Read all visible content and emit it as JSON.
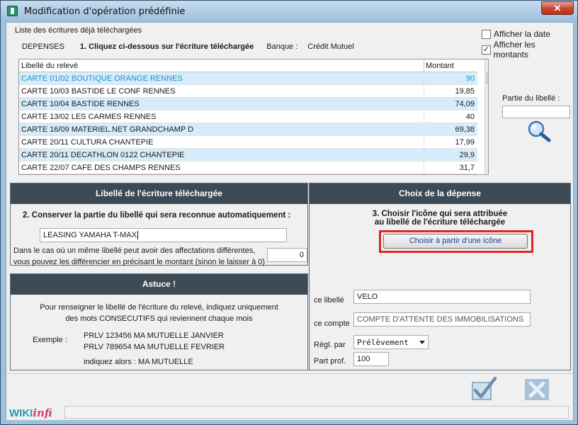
{
  "window": {
    "title": "Modification d'opération prédéfinie",
    "close_label": "✕"
  },
  "list_section": {
    "label": "Liste des écritures déjà téléchargées",
    "category": "DEPENSES",
    "step1": "1. Cliquez ci-dessous sur l'écriture téléchargée",
    "bank_label": "Banque :",
    "bank_name": "Crédit Mutuel",
    "show_date_label": "Afficher la date",
    "show_date_checked": false,
    "show_amounts_label": "Afficher les montants",
    "show_amounts_checked": true,
    "columns": [
      "Libellé du relevé",
      "Montant"
    ],
    "rows": [
      {
        "label": "CARTE 01/02 BOUTIQUE ORANGE RENNES",
        "amount": "90",
        "selected": true
      },
      {
        "label": "CARTE 10/03 BASTIDE LE CONF RENNES",
        "amount": "19,85",
        "selected": false
      },
      {
        "label": "CARTE 10/04 BASTIDE RENNES",
        "amount": "74,09",
        "selected": false
      },
      {
        "label": "CARTE 13/02 LES CARMES RENNES",
        "amount": "40",
        "selected": false
      },
      {
        "label": "CARTE 16/09 MATERIEL.NET GRANDCHAMP D",
        "amount": "69,38",
        "selected": false
      },
      {
        "label": "CARTE 20/11 CULTURA CHANTEPIE",
        "amount": "17,99",
        "selected": false
      },
      {
        "label": "CARTE 20/11 DECATHLON 0122 CHANTEPIE",
        "amount": "29,9",
        "selected": false
      },
      {
        "label": "CARTE 22/07 CAFE DES CHAMPS RENNES",
        "amount": "31,7",
        "selected": false
      }
    ],
    "partial_label": "Partie du libellé :",
    "partial_value": ""
  },
  "libelle_panel": {
    "title": "Libellé de l'écriture téléchargée",
    "step2": "2. Conserver la partie du libellé qui sera reconnue automatiquement :",
    "value": "LEASING YAMAHA T-MAX",
    "note1": "Dans le cas où un même libellé peut avoir des affectations différentes,",
    "note2": "vous pouvez les différencier en précisant le montant (sinon le laisser à 0)",
    "amount": "0"
  },
  "depense_panel": {
    "title": "Choix de la dépense",
    "step3_line1": "3. Choisir l'icône qui sera attribuée",
    "step3_line2": "au libellé de l'écriture téléchargée",
    "choose_button": "Choisir à partir d'une icône",
    "label_label": "ce libellé",
    "label_value": "VELO",
    "account_label": "ce compte",
    "account_value": "COMPTE D'ATTENTE DES IMMOBILISATIONS",
    "regl_label": "Règl. par",
    "regl_value": "Prélèvement",
    "part_label": "Part prof.",
    "part_value": "100"
  },
  "astuce_panel": {
    "title": "Astuce !",
    "text1": "Pour renseigner le libellé de l'écriture du relevé, indiquez uniquement",
    "text2": "des mots CONSECUTIFS qui reviennent chaque mois",
    "example_label": "Exemple :",
    "example1": "PRLV 123456 MA MUTUELLE JANVIER",
    "example2": "PRLV 789654 MA MUTUELLE FEVRIER",
    "alors": "indiquez alors :  MA MUTUELLE"
  },
  "footer": {
    "logo_wiki": "WIKI",
    "logo_infi": "infi"
  },
  "colors": {
    "panel_header": "#3c4a56",
    "selected_row_text": "#1e8fd6",
    "alt_row": "#d6ecfa",
    "highlight": "#e32323"
  }
}
